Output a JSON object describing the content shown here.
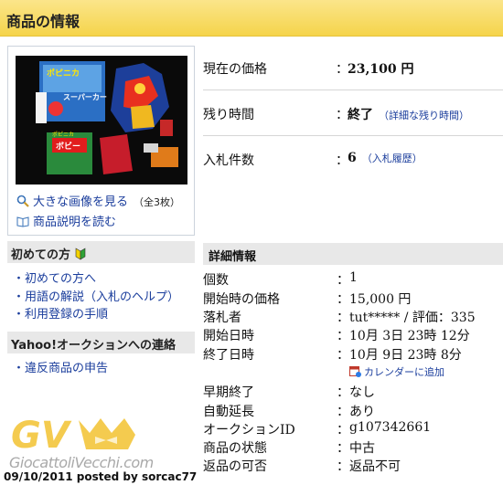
{
  "header": {
    "title": "商品の情報"
  },
  "image_panel": {
    "enlarge_link": "大きな画像を見る",
    "enlarge_note": "（全3枚）",
    "description_link": "商品説明を読む",
    "box_text_1": "ポピニカ",
    "box_text_2": "スーパーカー",
    "box_text_3": "ボビー",
    "box_text_4": "ポピニカ"
  },
  "summary": {
    "price_label": "現在の価格",
    "price_value": "23,100 円",
    "time_label": "残り時間",
    "time_value": "終了",
    "time_link": "（詳細な残り時間）",
    "bids_label": "入札件数",
    "bids_value": "6",
    "bids_link": "（入札履歴）",
    "colon": "："
  },
  "sidebar": {
    "beginners_heading": "初めての方",
    "beginner_links": [
      "初めての方へ",
      "用語の解説（入札のヘルプ）",
      "利用登録の手順"
    ],
    "contact_heading": "Yahoo!オークションへの連絡",
    "contact_links": [
      "違反商品の申告"
    ]
  },
  "details": {
    "heading": "詳細情報",
    "rows": [
      {
        "label": "個数",
        "value": "1"
      },
      {
        "label": "開始時の価格",
        "value": "15,000 円"
      },
      {
        "label": "落札者",
        "value": "tut***** / 評価：335"
      },
      {
        "label": "開始日時",
        "value": "10月 3日 23時 12分"
      },
      {
        "label": "終了日時",
        "value": "10月 9日 23時 8分"
      },
      {
        "label": "早期終了",
        "value": "なし"
      },
      {
        "label": "自動延長",
        "value": "あり"
      },
      {
        "label": "オークションID",
        "value": "g107342661"
      },
      {
        "label": "商品の状態",
        "value": "中古"
      },
      {
        "label": "返品の可否",
        "value": "返品不可"
      }
    ],
    "calendar_link": "カレンダーに追加"
  },
  "watermark": {
    "logo": "GV",
    "site": "GiocattoliVecchi.com",
    "posted": "09/10/2011 posted by sorcac77"
  },
  "colors": {
    "header_bg": "#f5d44b",
    "link": "#1a3d9c",
    "section_bg": "#e8e8e8",
    "watermark": "#f2c230"
  }
}
